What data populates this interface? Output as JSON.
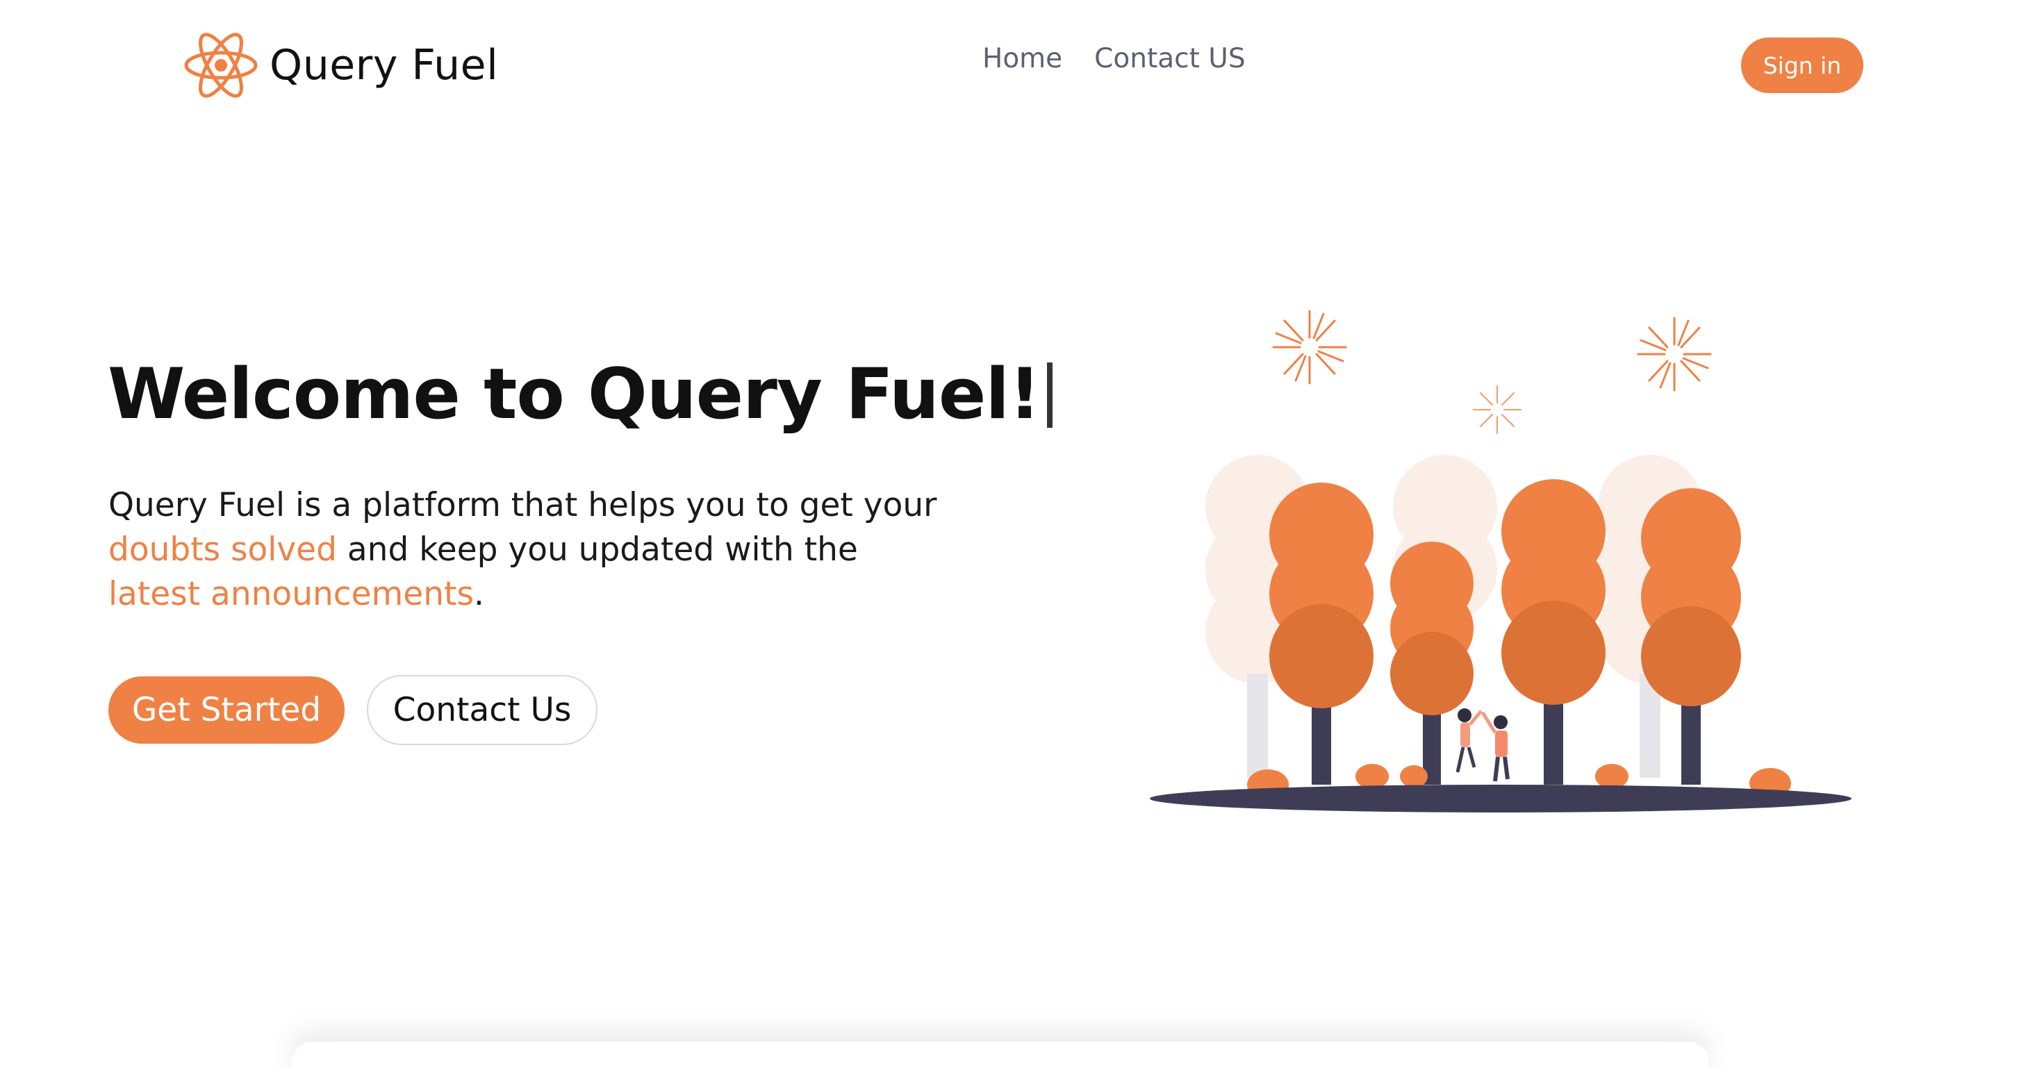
{
  "brand": {
    "name": "Query Fuel",
    "logo_icon": "atom-icon"
  },
  "nav": {
    "items": [
      "Home",
      "Contact US"
    ]
  },
  "header": {
    "signin_label": "Sign in"
  },
  "hero": {
    "title": "Welcome to Query Fuel!",
    "desc_part1": "Query Fuel is a platform that helps you to get your",
    "desc_highlight1": "doubts solved",
    "desc_part2": " and keep you updated with the",
    "desc_highlight2": "latest announcements",
    "desc_end": ".",
    "primary_label": "Get Started",
    "secondary_label": "Contact Us"
  },
  "illustration": {
    "name": "celebration-trees-illustration"
  },
  "colors": {
    "accent": "#ef8144",
    "text": "#111111",
    "nav": "#5b6170",
    "ground": "#3f3d56"
  }
}
